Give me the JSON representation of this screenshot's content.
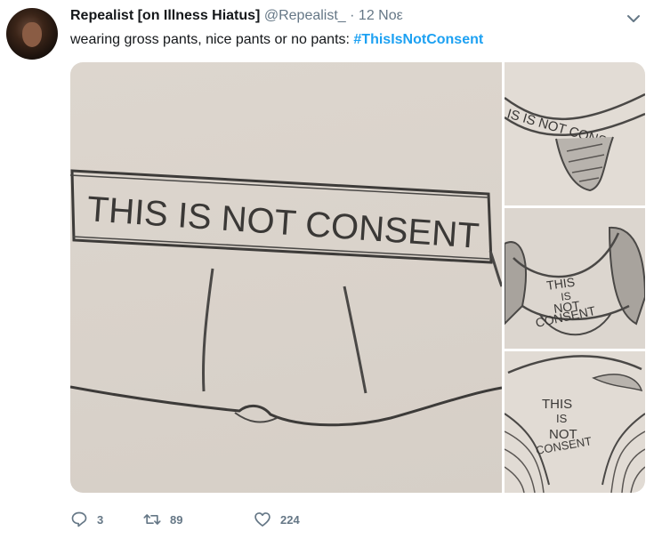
{
  "tweet": {
    "display_name": "Repealist [on Illness Hiatus]",
    "handle": "@Repealist_",
    "separator": "·",
    "date": "12 Noε",
    "text_prefix": "wearing gross pants, nice pants or no pants: ",
    "hashtag": "#ThisIsNotConsent"
  },
  "media": {
    "main_text": "THIS IS NOT CONSENT",
    "side1_text": "IS IS NOT CONS",
    "side2_lines": [
      "THIS",
      "IS",
      "NOT",
      "CONSENT"
    ],
    "side3_lines": [
      "THIS",
      "IS",
      "NOT",
      "CONSENT"
    ]
  },
  "actions": {
    "replies": "3",
    "retweets": "89",
    "likes": "224"
  },
  "colors": {
    "link": "#1da1f2",
    "muted": "#657786",
    "text": "#14171a"
  },
  "icons": {
    "avatar": "avatar",
    "menu": "chevron-down-icon",
    "reply": "reply-icon",
    "retweet": "retweet-icon",
    "like": "heart-icon"
  }
}
